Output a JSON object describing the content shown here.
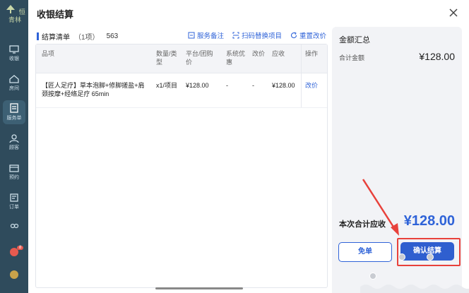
{
  "app": {
    "logo_text": "恒青林",
    "nav": [
      {
        "label": "收银",
        "icon": "monitor-icon"
      },
      {
        "label": "房间",
        "icon": "home-icon"
      },
      {
        "label": "服务单",
        "icon": "list-icon",
        "active": true
      },
      {
        "label": "顾客",
        "icon": "user-icon"
      },
      {
        "label": "预约",
        "icon": "calendar-icon"
      },
      {
        "label": "订单",
        "icon": "order-icon"
      },
      {
        "label": "",
        "icon": "staff-icon"
      },
      {
        "label": "",
        "icon": "app-icon",
        "badge": "8"
      }
    ]
  },
  "modal": {
    "title": "收银结算",
    "list_header": {
      "label": "结算清单",
      "count": "（1项）",
      "code": "563"
    },
    "actions": [
      {
        "label": "服务备注",
        "icon": "note-icon"
      },
      {
        "label": "扫码替换项目",
        "icon": "scan-icon"
      },
      {
        "label": "重置改价",
        "icon": "refresh-icon"
      }
    ],
    "table": {
      "headers": [
        "品项",
        "数量/类型",
        "平台/团购价",
        "系统优惠",
        "改价",
        "应收",
        "操作"
      ],
      "rows": [
        {
          "name": "【匠人足疗】草本泡脚+修脚搓盐+肩颈按摩+经络足疗 65min",
          "qty": "x1/项目",
          "price": "¥128.00",
          "discount": "-",
          "adjust": "-",
          "receivable": "¥128.00",
          "op": "改价"
        }
      ]
    },
    "summary": {
      "title": "金额汇总",
      "total_label": "合计金额",
      "total_value": "¥128.00",
      "due_label": "本次合计应收",
      "due_value": "¥128.00",
      "free_btn": "免单",
      "confirm_btn": "确认结算"
    }
  },
  "colors": {
    "accent": "#2f63d8",
    "highlight": "#e8413b",
    "sidebar": "#2f4b5c"
  }
}
